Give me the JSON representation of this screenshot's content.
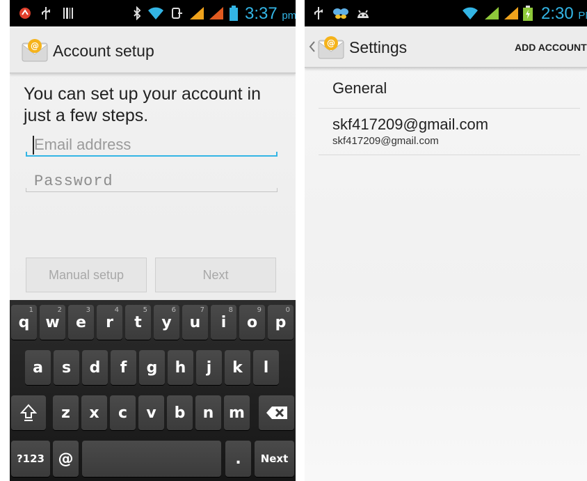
{
  "left": {
    "status_time": "3:37",
    "status_ampm": "pm",
    "app_title": "Account setup",
    "intro_text": "You can set up your account in just a few steps.",
    "email_placeholder": "Email address",
    "password_placeholder": "Password",
    "manual_setup_label": "Manual setup",
    "next_label": "Next",
    "keyboard": {
      "row1": [
        "q",
        "w",
        "e",
        "r",
        "t",
        "y",
        "u",
        "i",
        "o",
        "p"
      ],
      "row1_hints": [
        "1",
        "2",
        "3",
        "4",
        "5",
        "6",
        "7",
        "8",
        "9",
        "0"
      ],
      "row2": [
        "a",
        "s",
        "d",
        "f",
        "g",
        "h",
        "j",
        "k",
        "l"
      ],
      "row3": [
        "z",
        "x",
        "c",
        "v",
        "b",
        "n",
        "m"
      ],
      "symbols_key": "?123",
      "at_key": "@",
      "period_key": ".",
      "next_key": "Next"
    }
  },
  "right": {
    "status_time": "2:30",
    "status_ampm": "PM",
    "app_title": "Settings",
    "add_account_label": "ADD ACCOUNT",
    "general_label": "General",
    "account_title": "skf417209@gmail.com",
    "account_subtitle": "skf417209@gmail.com"
  },
  "colors": {
    "accent": "#33b5e5",
    "underline_active": "#33b5e5",
    "underline_inactive": "#c4c4c4"
  }
}
